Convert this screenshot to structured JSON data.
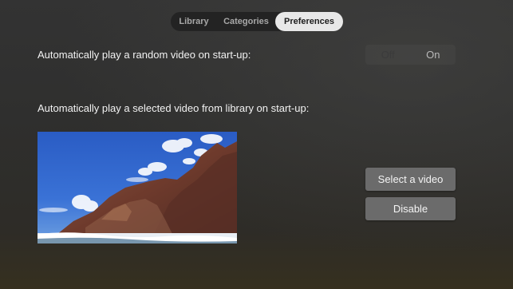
{
  "tabs": [
    {
      "label": "Library"
    },
    {
      "label": "Categories"
    },
    {
      "label": "Preferences"
    }
  ],
  "active_tab": "Preferences",
  "preferences": {
    "random_video_label": "Automatically play a random video on start-up:",
    "random_video_toggle": {
      "off_label": "Off",
      "on_label": "On",
      "selected": "On"
    },
    "selected_video_label": "Automatically play a selected video from library on start-up:",
    "select_video_button": "Select a video",
    "disable_button": "Disable"
  },
  "colors": {
    "tab_active_bg": "#e8e8e8",
    "button_bg": "#6b6b6b",
    "sky": "#2f63c8",
    "cliff": "#7a4636"
  },
  "icons": []
}
